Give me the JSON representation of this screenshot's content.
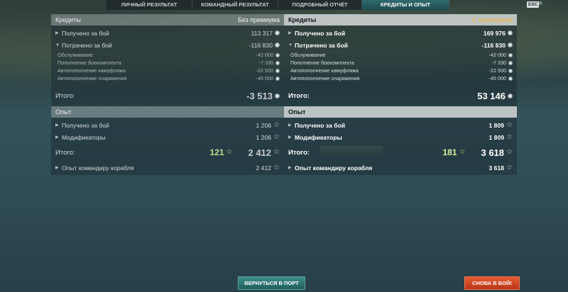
{
  "tabs": [
    {
      "label": "ЛИЧНЫЙ РЕЗУЛЬТАТ",
      "active": false
    },
    {
      "label": "КОМАНДНЫЙ РЕЗУЛЬТАТ",
      "active": false
    },
    {
      "label": "ПОДРОБНЫЙ ОТЧЁТ",
      "active": false
    },
    {
      "label": "КРЕДИТЫ И ОПЫТ",
      "active": true
    }
  ],
  "esc_label": "ESC",
  "close_icon": "close-icon",
  "left": {
    "credits_title": "Кредиты",
    "credits_tag": "Без премиума",
    "earned_label": "Получено за бой",
    "earned_value": "113 317",
    "spent_label": "Потрачено за бой",
    "spent_value": "-116 830",
    "expenses": [
      {
        "label": "Обслуживание",
        "value": "-42 000"
      },
      {
        "label": "Пополнение боекомплекта",
        "value": "-7 330"
      },
      {
        "label": "Автопополнение камуфляжа",
        "value": "-22 500"
      },
      {
        "label": "Автопополнение снаряжения",
        "value": "-45 000"
      }
    ],
    "total_label": "Итого:",
    "total_value": "-3 513",
    "xp_title": "Опыт",
    "xp_earned_label": "Получено за бой",
    "xp_earned_value": "1 206",
    "modifiers_label": "Модификаторы",
    "modifiers_value": "1 206",
    "xp_total_label": "Итого:",
    "xp_free_value": "121",
    "xp_total_value": "2 412",
    "commander_label": "Опыт командиру корабля",
    "commander_value": "2 412"
  },
  "right": {
    "credits_title": "Кредиты",
    "credits_tag": "С премиумом",
    "earned_label": "Получено за бой",
    "earned_value": "169 976",
    "spent_label": "Потрачено за бой",
    "spent_value": "-116 830",
    "expenses": [
      {
        "label": "Обслуживание",
        "value": "-42 000"
      },
      {
        "label": "Пополнение боекомплекта",
        "value": "-7 330"
      },
      {
        "label": "Автопополнение камуфляжа",
        "value": "-22 500"
      },
      {
        "label": "Автопополнение снаряжения",
        "value": "-45 000"
      }
    ],
    "total_label": "Итого:",
    "total_value": "53 146",
    "xp_title": "Опыт",
    "xp_earned_label": "Получено за бой",
    "xp_earned_value": "1 809",
    "modifiers_label": "Модификаторы",
    "modifiers_value": "1 809",
    "xp_total_label": "Итого:",
    "xp_free_value": "181",
    "xp_total_value": "3 618",
    "commander_label": "Опыт командиру корабля",
    "commander_value": "3 618"
  },
  "buttons": {
    "port_label": "ВЕРНУТЬСЯ В ПОРТ",
    "battle_label": "СНОВА В БОЙ!"
  },
  "colors": {
    "accent_teal": "#2f6a6c",
    "premium_gold": "#f1b43b",
    "battle_orange": "#e45a2f",
    "free_xp_green": "#b8e08f"
  },
  "icons": {
    "credit": "coin-icon",
    "xp": "star-icon",
    "expand": "triangle-icon"
  }
}
